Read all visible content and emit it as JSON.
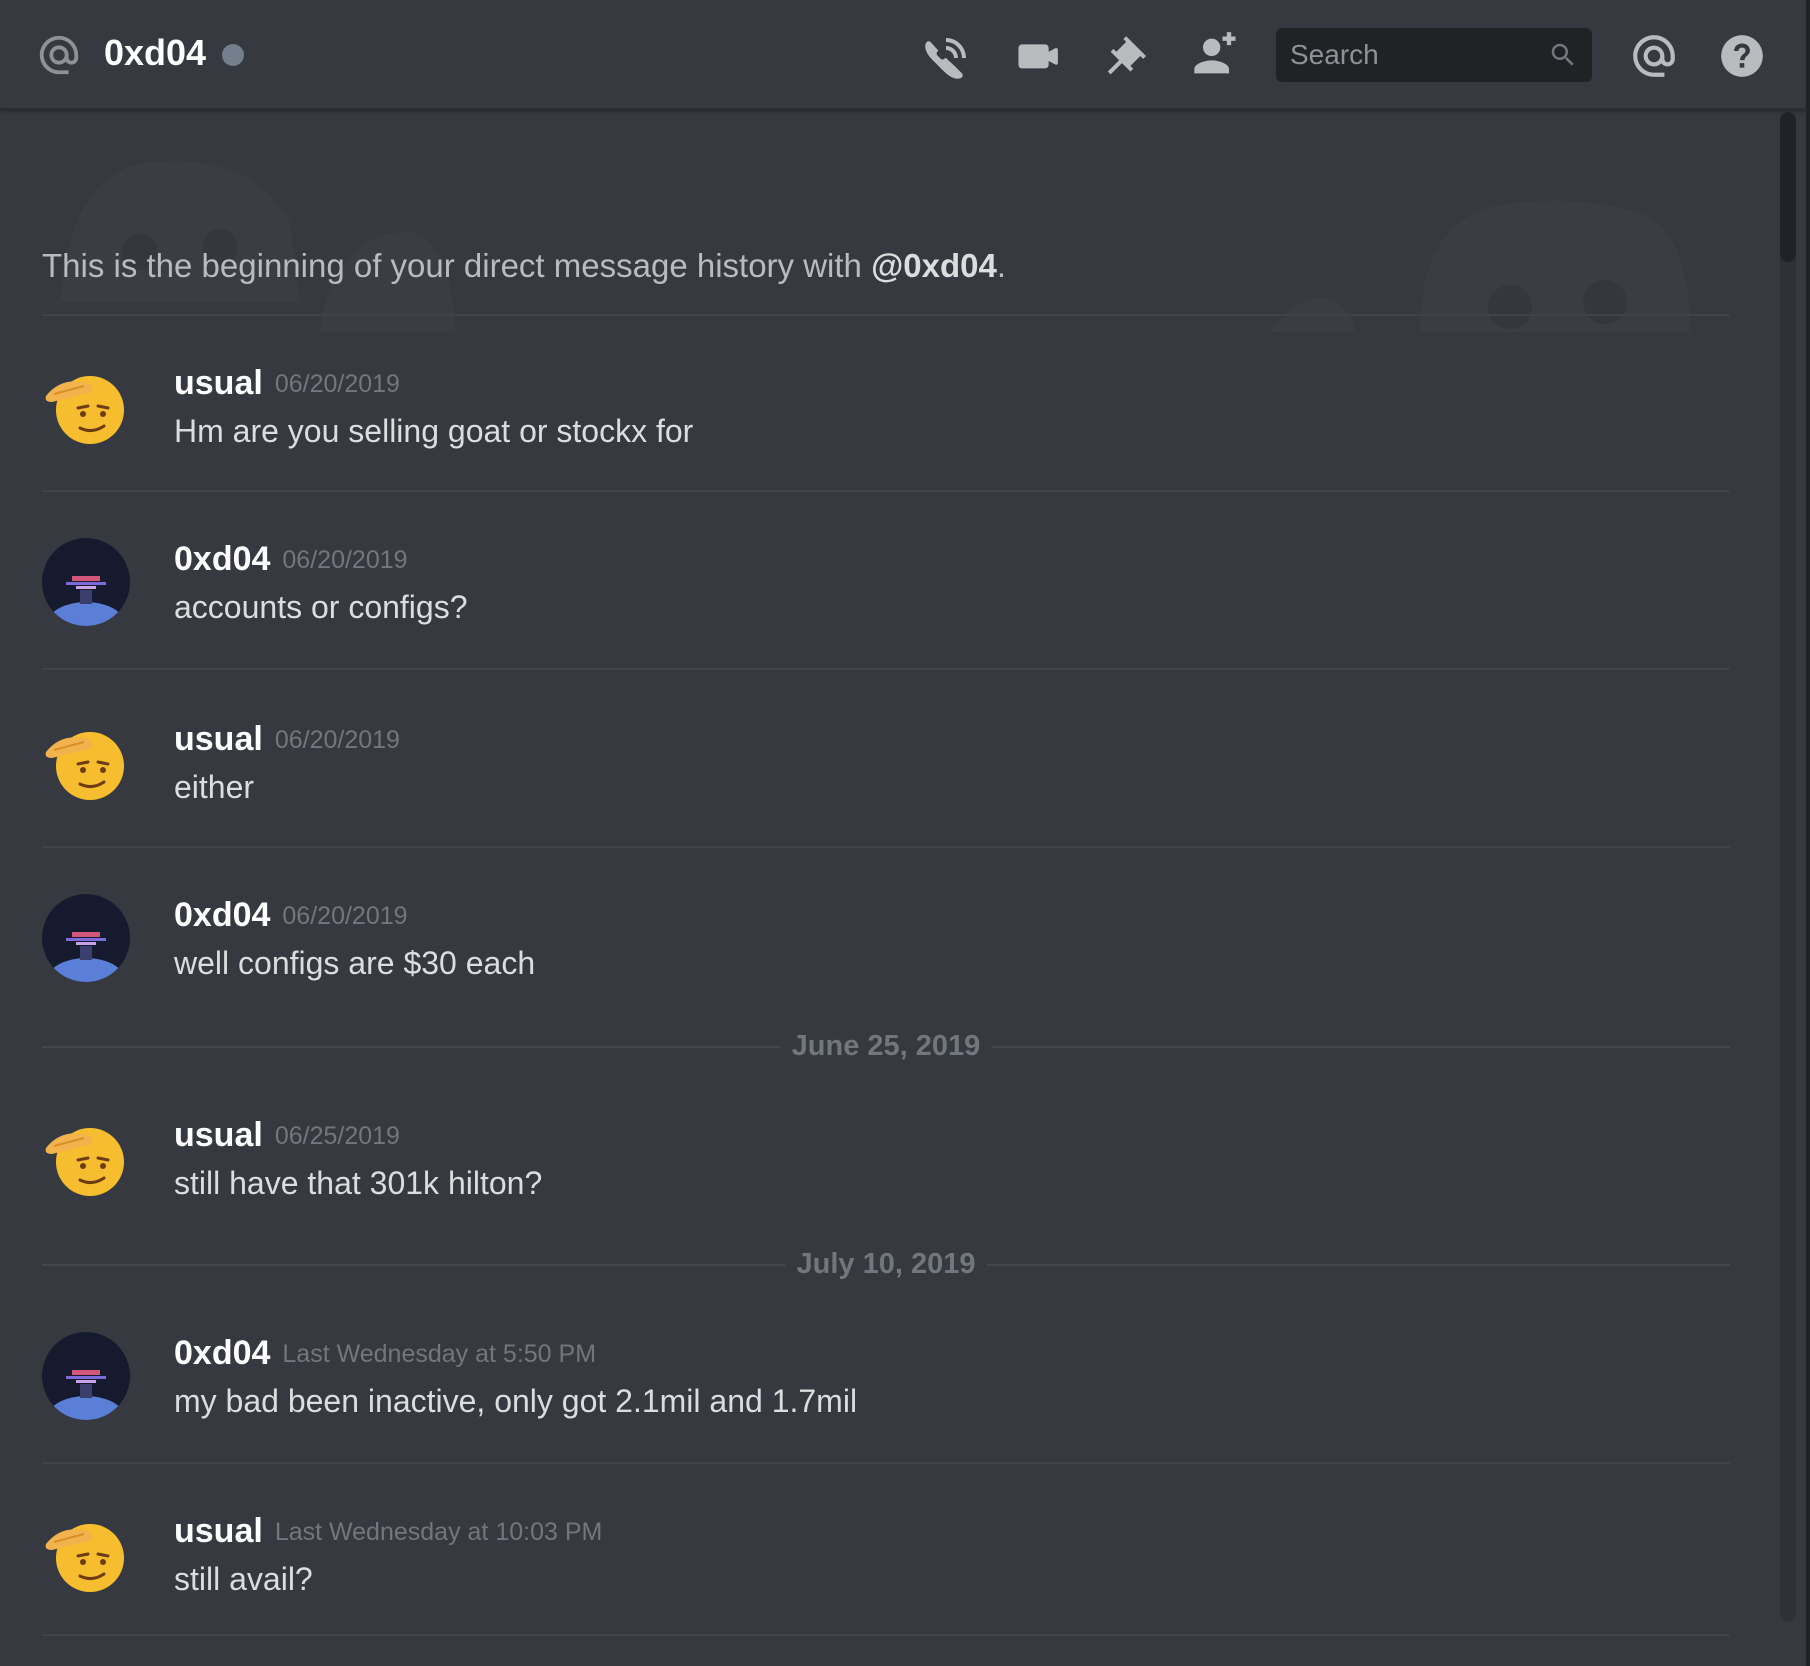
{
  "header": {
    "title": "0xd04",
    "search_placeholder": "Search",
    "icons": [
      "at-icon",
      "voice-call-icon",
      "video-call-icon",
      "pinned-messages-icon",
      "add-friend-icon",
      "search-icon",
      "mentions-icon",
      "help-icon"
    ]
  },
  "intro": {
    "text": "This is the beginning of your direct message history with ",
    "handle": "@0xd04",
    "end": "."
  },
  "messages": [
    {
      "author": "usual",
      "timestamp": "06/20/2019",
      "text": "Hm are you selling goat or stockx for",
      "avatar": "saluting-face-emoji"
    },
    {
      "author": "0xd04",
      "timestamp": "06/20/2019",
      "text": "accounts or configs?",
      "avatar": "dark-glitch-avatar"
    },
    {
      "author": "usual",
      "timestamp": "06/20/2019",
      "text": "either",
      "avatar": "saluting-face-emoji"
    },
    {
      "author": "0xd04",
      "timestamp": "06/20/2019",
      "text": "well configs are $30 each",
      "avatar": "dark-glitch-avatar"
    },
    {
      "author": "usual",
      "timestamp": "06/25/2019",
      "text": "still have that 301k hilton?",
      "avatar": "saluting-face-emoji"
    },
    {
      "author": "0xd04",
      "timestamp": "Last Wednesday at 5:50 PM",
      "text": "my bad been inactive, only got 2.1mil and 1.7mil",
      "avatar": "dark-glitch-avatar"
    },
    {
      "author": "usual",
      "timestamp": "Last Wednesday at 10:03 PM",
      "text": "still avail?",
      "avatar": "saluting-face-emoji"
    }
  ],
  "date_dividers": [
    "June 25, 2019",
    "July 10, 2019"
  ],
  "colors": {
    "background": "#36393f",
    "header_text": "#ffffff",
    "timestamp": "#72767d",
    "message_text": "#dcddde",
    "status_offline": "#747f8d",
    "search_bg": "#202225"
  }
}
